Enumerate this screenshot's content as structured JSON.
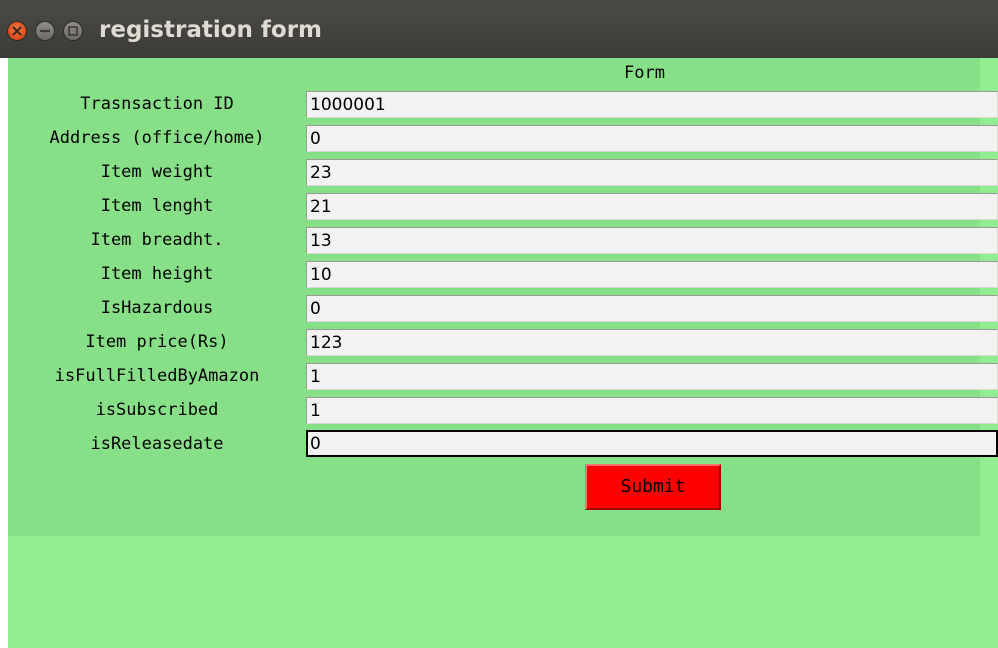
{
  "window": {
    "title": "registration form"
  },
  "form": {
    "heading": "Form",
    "fields": [
      {
        "label": "Trasnsaction ID",
        "value": "1000001"
      },
      {
        "label": "Address (office/home)",
        "value": "0"
      },
      {
        "label": "Item weight",
        "value": "23"
      },
      {
        "label": "Item lenght",
        "value": "21"
      },
      {
        "label": "Item breadht.",
        "value": "13"
      },
      {
        "label": "Item height",
        "value": "10"
      },
      {
        "label": "IsHazardous",
        "value": "0"
      },
      {
        "label": "Item price(Rs)",
        "value": "123"
      },
      {
        "label": "isFullFilledByAmazon",
        "value": "1"
      },
      {
        "label": "isSubscribed",
        "value": "1"
      },
      {
        "label": "isReleasedate",
        "value": "0"
      }
    ],
    "submit_label": "Submit"
  },
  "colors": {
    "background": "#90ee90",
    "form_frame": "#87e087",
    "submit_button": "#ff0000",
    "titlebar": "#3c3b37",
    "close_button": "#dd4814"
  },
  "icons": {
    "close": "close-icon",
    "minimize": "minimize-icon",
    "maximize": "maximize-icon"
  }
}
